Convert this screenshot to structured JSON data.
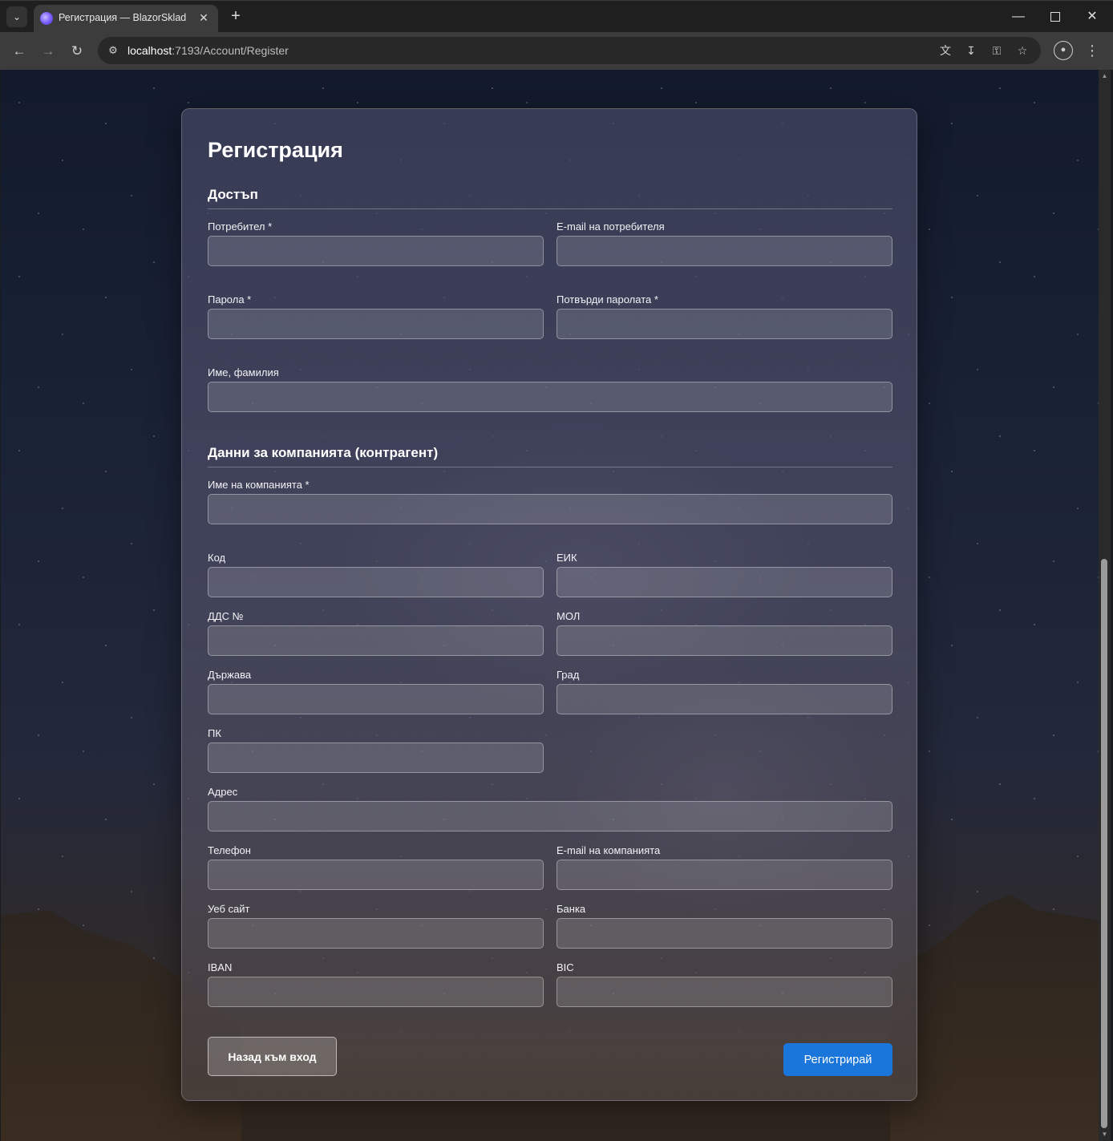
{
  "browser": {
    "tab_title": "Регистрация — BlazorSklad",
    "url_host": "localhost",
    "url_rest": ":7193/Account/Register",
    "icons": {
      "tab_list": "chevron-down-icon",
      "close_tab": "close-icon",
      "new_tab": "plus-icon",
      "back": "arrow-left-icon",
      "forward": "arrow-right-icon",
      "reload": "reload-icon",
      "site_info": "tune-icon",
      "translate": "translate-icon",
      "install": "install-app-icon",
      "passwords": "key-icon",
      "bookmark": "star-icon",
      "profile": "profile-icon",
      "menu": "more-vert-icon"
    }
  },
  "form": {
    "title": "Регистрация",
    "access_section": "Достъп",
    "company_section": "Данни за компанията (контрагент)",
    "fields": {
      "username": {
        "label": "Потребител *",
        "value": ""
      },
      "user_email": {
        "label": "E-mail на потребителя",
        "value": ""
      },
      "password": {
        "label": "Парола *",
        "value": ""
      },
      "confirm_password": {
        "label": "Потвърди паролата *",
        "value": ""
      },
      "full_name": {
        "label": "Име, фамилия",
        "value": ""
      },
      "company_name": {
        "label": "Име на компанията *",
        "value": ""
      },
      "code": {
        "label": "Код",
        "value": ""
      },
      "eik": {
        "label": "ЕИК",
        "value": ""
      },
      "vat_no": {
        "label": "ДДС №",
        "value": ""
      },
      "mol": {
        "label": "МОЛ",
        "value": ""
      },
      "country": {
        "label": "Държава",
        "value": ""
      },
      "city": {
        "label": "Град",
        "value": ""
      },
      "postcode": {
        "label": "ПК",
        "value": ""
      },
      "address": {
        "label": "Адрес",
        "value": ""
      },
      "phone": {
        "label": "Телефон",
        "value": ""
      },
      "company_email": {
        "label": "E-mail на компанията",
        "value": ""
      },
      "website": {
        "label": "Уеб сайт",
        "value": ""
      },
      "bank": {
        "label": "Банка",
        "value": ""
      },
      "iban": {
        "label": "IBAN",
        "value": ""
      },
      "bic": {
        "label": "BIC",
        "value": ""
      }
    },
    "back_button": "Назад към вход",
    "register_button": "Регистрирай"
  },
  "colors": {
    "primary_button": "#1b76db",
    "browser_toolbar": "#3c3c3c",
    "browser_tabbar": "#1f1f1f"
  }
}
